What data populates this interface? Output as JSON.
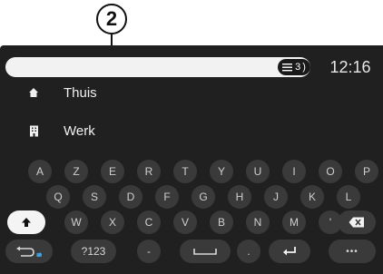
{
  "callout": {
    "number": "2"
  },
  "topbar": {
    "list_count": "3",
    "clock": "12:16"
  },
  "suggestions": [
    {
      "label": "Thuis",
      "icon": "home-icon"
    },
    {
      "label": "Werk",
      "icon": "building-icon"
    }
  ],
  "keyboard": {
    "row1": [
      "A",
      "Z",
      "E",
      "R",
      "T",
      "Y",
      "U",
      "I",
      "O",
      "P"
    ],
    "row2": [
      "Q",
      "S",
      "D",
      "F",
      "G",
      "H",
      "J",
      "K",
      "L"
    ],
    "row3": [
      "W",
      "X",
      "C",
      "V",
      "B",
      "N",
      "M",
      "'"
    ],
    "row4": {
      "numbers": "?123",
      "dash": "-",
      "dot": ".",
      "more": "•••"
    }
  },
  "icons": {
    "shift": "shift-up-arrow-icon",
    "backspace": "backspace-icon",
    "language": "language-switch-icon",
    "space": "space-bar-icon",
    "enter": "enter-icon"
  }
}
